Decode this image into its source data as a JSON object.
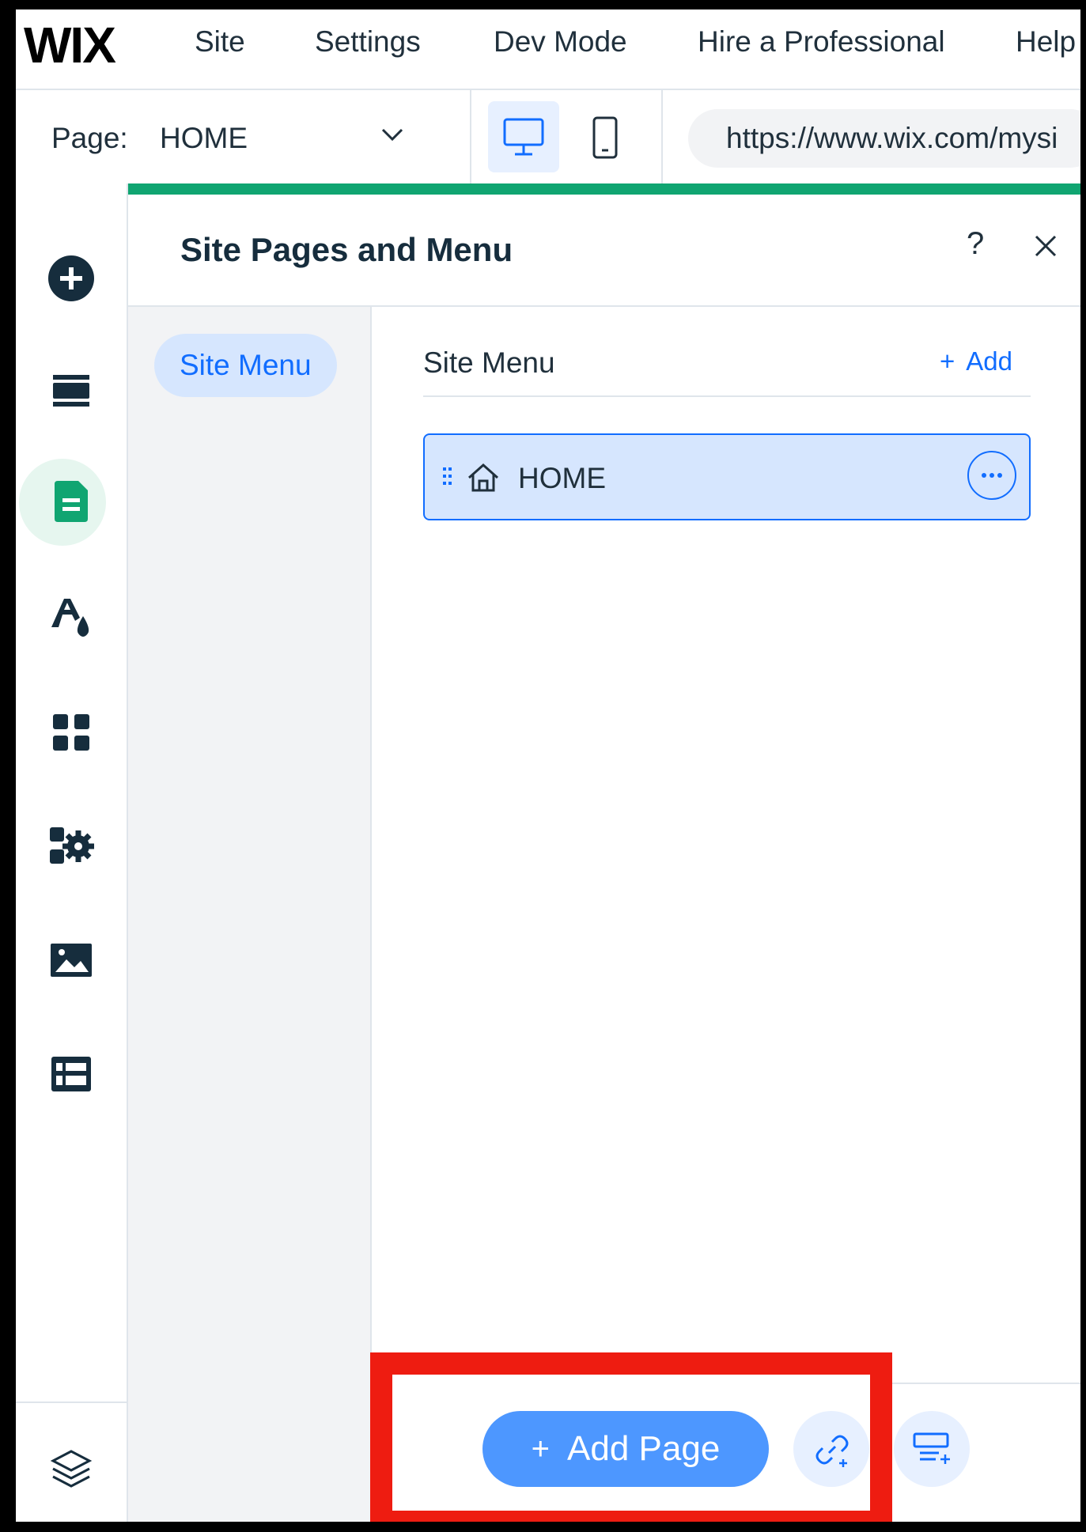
{
  "topbar": {
    "logo": "WIX",
    "menu": [
      "Site",
      "Settings",
      "Dev Mode",
      "Hire a Professional",
      "Help"
    ]
  },
  "toolbar": {
    "page_label": "Page:",
    "page_value": "HOME",
    "url": "https://www.wix.com/mysi"
  },
  "rail": {
    "icons": [
      "add-elements-icon",
      "sections-icon",
      "pages-icon",
      "theme-icon",
      "apps-icon",
      "business-apps-icon",
      "media-icon",
      "cms-icon",
      "layers-icon"
    ],
    "active": "pages-icon"
  },
  "panel": {
    "title": "Site Pages and Menu",
    "help": "?",
    "left_tab": "Site Menu",
    "section_title": "Site Menu",
    "add_label": "Add",
    "pages": [
      {
        "label": "HOME",
        "icon": "home-icon"
      }
    ]
  },
  "footer": {
    "add_page_label": "Add Page"
  },
  "colors": {
    "accent": "#116dff",
    "progress": "#10a571",
    "highlight_box": "#ee1c11",
    "selected_row": "#d6e6fe"
  }
}
